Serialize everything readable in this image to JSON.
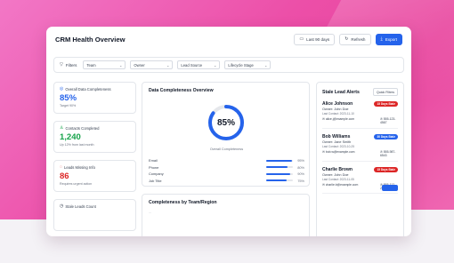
{
  "header": {
    "title": "CRM Health Overview",
    "date_range_label": "Last 90 days",
    "refresh_label": "Refresh",
    "export_label": "Export"
  },
  "filters": {
    "label": "Filters",
    "selects": [
      {
        "value": "Team"
      },
      {
        "value": "Owner"
      },
      {
        "value": "Lead Source"
      },
      {
        "value": "Lifecycle Stage"
      }
    ]
  },
  "stats": [
    {
      "label": "Overall Data Completeness",
      "value": "85%",
      "sub": "Target 90%",
      "color": "#2563eb"
    },
    {
      "label": "Contacts Completed",
      "value": "1,240",
      "sub": "Up 12% from last month",
      "color": "#16a34a"
    },
    {
      "label": "Leads Missing Info",
      "value": "86",
      "sub": "Requires urgent action",
      "color": "#dc2626"
    },
    {
      "label": "Stale Leads Count",
      "value": "",
      "sub": "",
      "color": "#374151"
    }
  ],
  "completeness": {
    "title": "Data Completeness Overview",
    "overall_percent": 85,
    "overall_label": "85%",
    "caption": "Overall Completeness",
    "fields": [
      {
        "name": "Email",
        "percent": 95,
        "label": "95%"
      },
      {
        "name": "Phone",
        "percent": 80,
        "label": "80%"
      },
      {
        "name": "Company",
        "percent": 90,
        "label": "90%"
      },
      {
        "name": "Job Title",
        "percent": 75,
        "label": "75%"
      }
    ]
  },
  "team_region": {
    "title": "Completeness by Team/Region",
    "peek": "..."
  },
  "stale_alerts": {
    "title": "Stale Lead Alerts",
    "quick_filters_label": "Quick Filters",
    "items": [
      {
        "name": "Alice Johnson",
        "badge": "15 Days Stale",
        "badge_color": "#dc2626",
        "owner": "Owner: John Doe",
        "last": "Last Contact: 2023-11-10",
        "email": "alice.j@example.com",
        "phone": "555-123-4567"
      },
      {
        "name": "Bob Williams",
        "badge": "30 Days Stale",
        "badge_color": "#2563eb",
        "owner": "Owner: Jane Smith",
        "last": "Last Contact: 2023-10-25",
        "email": "bob.w@example.com",
        "phone": "555-987-6543"
      },
      {
        "name": "Charlie Brown",
        "badge": "15 Days Stale",
        "badge_color": "#dc2626",
        "owner": "Owner: John Doe",
        "last": "Last Contact: 2023-11-05",
        "email": "charlie.b@example.com",
        "phone": "555-112-2233"
      }
    ]
  },
  "colors": {
    "accent": "#2563eb",
    "background": "#ec4fa8"
  }
}
